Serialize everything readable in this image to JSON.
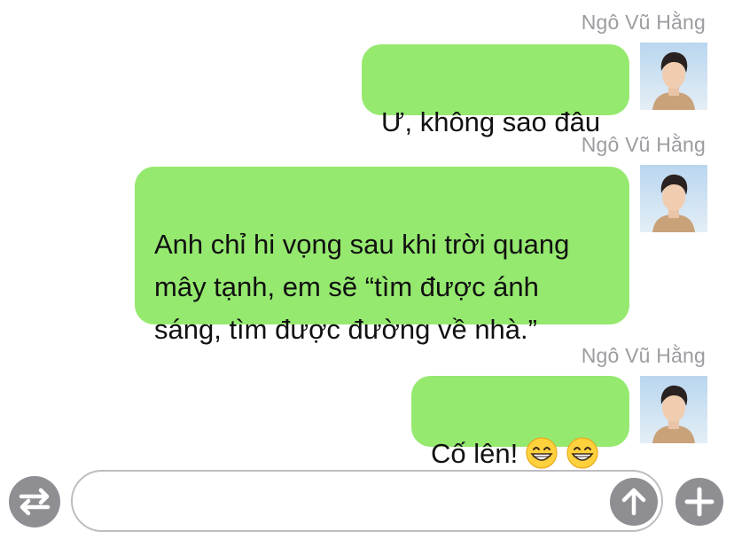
{
  "messages": [
    {
      "sender": "Ngô Vũ Hằng",
      "text": "Ư, không sao đâu",
      "emojis": []
    },
    {
      "sender": "Ngô Vũ Hằng",
      "text": "Anh chỉ hi vọng sau khi trời quang\nmây tạnh, em sẽ “tìm được ánh\nsáng, tìm được đường về nhà.”",
      "emojis": []
    },
    {
      "sender": "Ngô Vũ Hằng",
      "text": "Cố lên!",
      "emojis": [
        "grinning-face-icon",
        "grinning-face-icon"
      ]
    }
  ],
  "composer": {
    "value": "",
    "placeholder": "",
    "icons": {
      "left": "swap-arrows-icon",
      "send": "arrow-up-icon",
      "add": "plus-icon"
    }
  },
  "colors": {
    "bubble": "#95e96f",
    "sender_text": "#9c9ca1",
    "button": "#8e8e93"
  }
}
